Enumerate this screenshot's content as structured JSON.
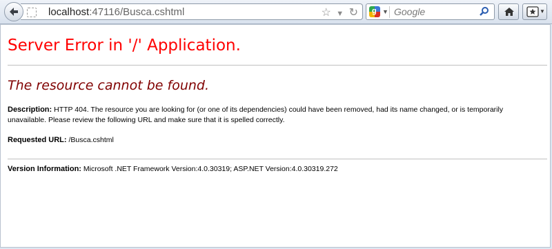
{
  "browser": {
    "url_host": "localhost",
    "url_rest": ":47116/Busca.cshtml",
    "search_placeholder": "Google",
    "icons": [
      "back-arrow-icon",
      "site-identity-icon",
      "bookmark-star-icon",
      "history-dropdown-icon",
      "reload-icon",
      "google-engine-icon",
      "search-magnifier-icon",
      "home-icon",
      "bookmarks-menu-icon"
    ]
  },
  "page": {
    "title": "Server Error in '/' Application.",
    "subtitle": "The resource cannot be found.",
    "description_label": "Description:",
    "description_text": "HTTP 404. The resource you are looking for (or one of its dependencies) could have been removed, had its name changed, or is temporarily unavailable.  Please review the following URL and make sure that it is spelled correctly.",
    "requested_url_label": "Requested URL:",
    "requested_url_value": "/Busca.cshtml",
    "version_label": "Version Information:",
    "version_value": "Microsoft .NET Framework Version:4.0.30319; ASP.NET Version:4.0.30319.272"
  },
  "colors": {
    "title": "#ff0000",
    "subtitle": "#800000",
    "toolbar": "#dce6f1"
  }
}
